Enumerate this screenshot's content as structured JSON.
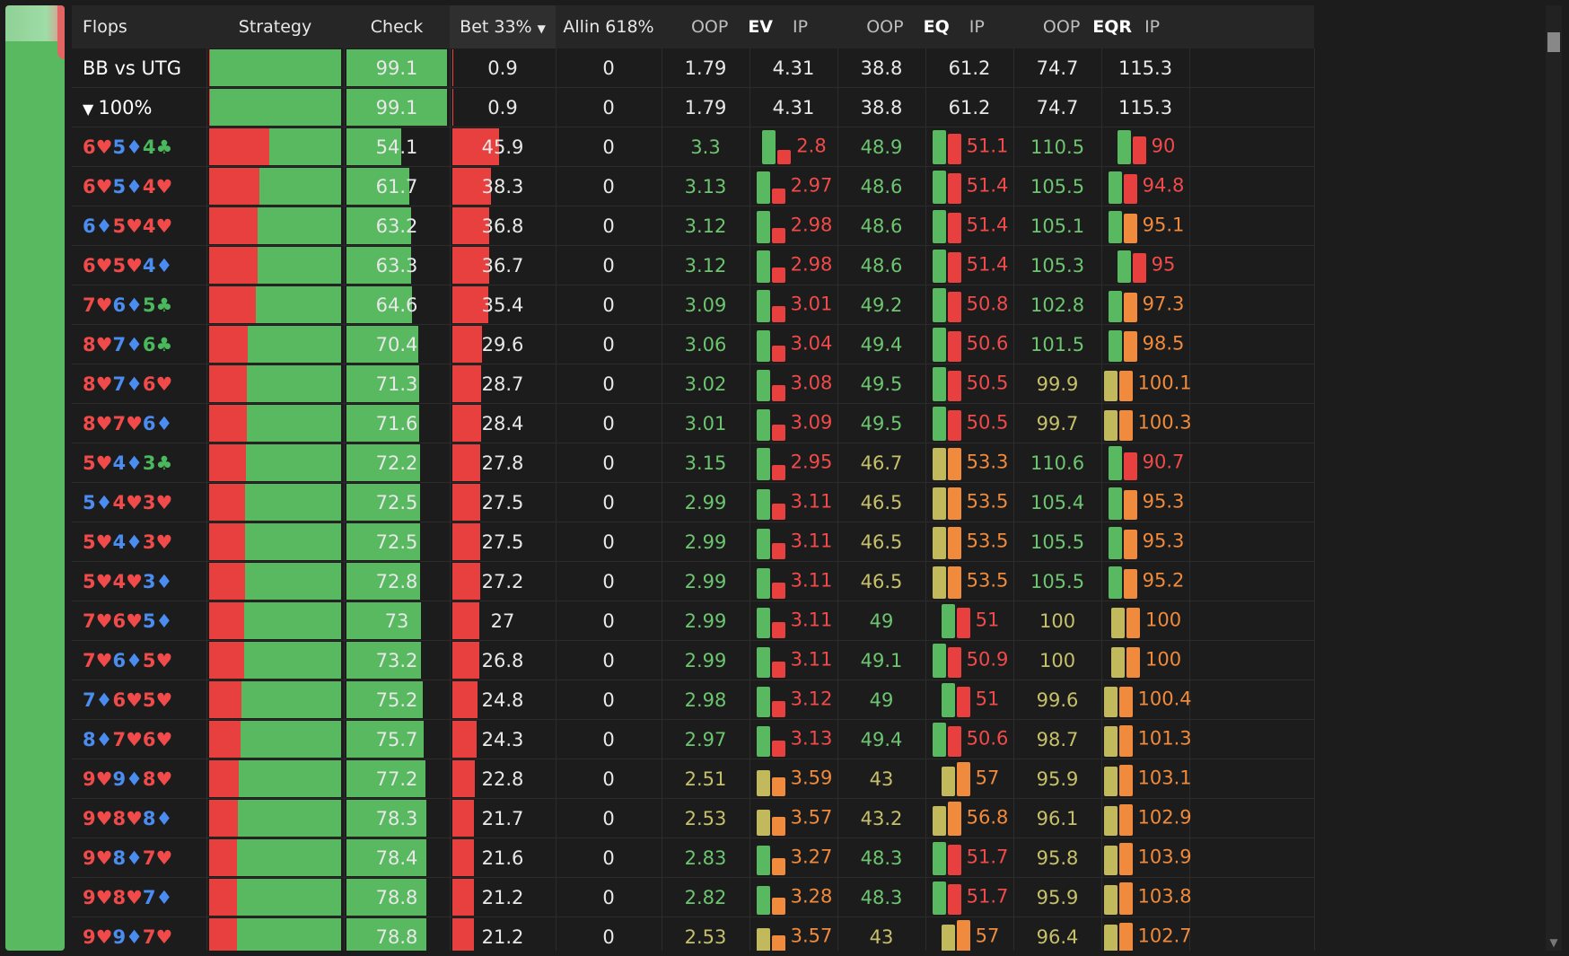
{
  "header": {
    "flops": "Flops",
    "strategy": "Strategy",
    "check": "Check",
    "bet": "Bet 33%",
    "allin": "Allin 618%",
    "ev_oop": "OOP",
    "ev": "EV",
    "ev_ip": "IP",
    "eq_oop": "OOP",
    "eq": "EQ",
    "eq_ip": "IP",
    "eqr_oop": "OOP",
    "eqr": "EQR",
    "eqr_ip": "IP"
  },
  "summary": [
    {
      "label": "BB vs UTG",
      "check": "99.1",
      "bet": "0.9",
      "allin": "0",
      "ev_oop": "1.79",
      "ev_ip": "4.31",
      "eq_oop": "38.8",
      "eq_ip": "61.2",
      "eqr_oop": "74.7",
      "eqr_ip": "115.3"
    },
    {
      "label": "100%",
      "filter_icon": "filter-icon",
      "check": "99.1",
      "bet": "0.9",
      "allin": "0",
      "ev_oop": "1.79",
      "ev_ip": "4.31",
      "eq_oop": "38.8",
      "eq_ip": "61.2",
      "eqr_oop": "74.7",
      "eqr_ip": "115.3"
    }
  ],
  "rows": [
    {
      "cards": [
        [
          "6",
          "h"
        ],
        [
          "5",
          "d"
        ],
        [
          "4",
          "c"
        ]
      ],
      "check": "54.1",
      "bet": "45.9",
      "allin": "0",
      "ev_oop": "3.3",
      "ev_ip": "2.8",
      "eq_oop": "48.9",
      "eq_ip": "51.1",
      "eqr_oop": "110.5",
      "eqr_ip": "90"
    },
    {
      "cards": [
        [
          "6",
          "h"
        ],
        [
          "5",
          "d"
        ],
        [
          "4",
          "h"
        ]
      ],
      "check": "61.7",
      "bet": "38.3",
      "allin": "0",
      "ev_oop": "3.13",
      "ev_ip": "2.97",
      "eq_oop": "48.6",
      "eq_ip": "51.4",
      "eqr_oop": "105.5",
      "eqr_ip": "94.8"
    },
    {
      "cards": [
        [
          "6",
          "d"
        ],
        [
          "5",
          "h"
        ],
        [
          "4",
          "h"
        ]
      ],
      "check": "63.2",
      "bet": "36.8",
      "allin": "0",
      "ev_oop": "3.12",
      "ev_ip": "2.98",
      "eq_oop": "48.6",
      "eq_ip": "51.4",
      "eqr_oop": "105.1",
      "eqr_ip": "95.1"
    },
    {
      "cards": [
        [
          "6",
          "h"
        ],
        [
          "5",
          "h"
        ],
        [
          "4",
          "d"
        ]
      ],
      "check": "63.3",
      "bet": "36.7",
      "allin": "0",
      "ev_oop": "3.12",
      "ev_ip": "2.98",
      "eq_oop": "48.6",
      "eq_ip": "51.4",
      "eqr_oop": "105.3",
      "eqr_ip": "95"
    },
    {
      "cards": [
        [
          "7",
          "h"
        ],
        [
          "6",
          "d"
        ],
        [
          "5",
          "c"
        ]
      ],
      "check": "64.6",
      "bet": "35.4",
      "allin": "0",
      "ev_oop": "3.09",
      "ev_ip": "3.01",
      "eq_oop": "49.2",
      "eq_ip": "50.8",
      "eqr_oop": "102.8",
      "eqr_ip": "97.3"
    },
    {
      "cards": [
        [
          "8",
          "h"
        ],
        [
          "7",
          "d"
        ],
        [
          "6",
          "c"
        ]
      ],
      "check": "70.4",
      "bet": "29.6",
      "allin": "0",
      "ev_oop": "3.06",
      "ev_ip": "3.04",
      "eq_oop": "49.4",
      "eq_ip": "50.6",
      "eqr_oop": "101.5",
      "eqr_ip": "98.5"
    },
    {
      "cards": [
        [
          "8",
          "h"
        ],
        [
          "7",
          "d"
        ],
        [
          "6",
          "h"
        ]
      ],
      "check": "71.3",
      "bet": "28.7",
      "allin": "0",
      "ev_oop": "3.02",
      "ev_ip": "3.08",
      "eq_oop": "49.5",
      "eq_ip": "50.5",
      "eqr_oop": "99.9",
      "eqr_ip": "100.1"
    },
    {
      "cards": [
        [
          "8",
          "h"
        ],
        [
          "7",
          "h"
        ],
        [
          "6",
          "d"
        ]
      ],
      "check": "71.6",
      "bet": "28.4",
      "allin": "0",
      "ev_oop": "3.01",
      "ev_ip": "3.09",
      "eq_oop": "49.5",
      "eq_ip": "50.5",
      "eqr_oop": "99.7",
      "eqr_ip": "100.3"
    },
    {
      "cards": [
        [
          "5",
          "h"
        ],
        [
          "4",
          "d"
        ],
        [
          "3",
          "c"
        ]
      ],
      "check": "72.2",
      "bet": "27.8",
      "allin": "0",
      "ev_oop": "3.15",
      "ev_ip": "2.95",
      "eq_oop": "46.7",
      "eq_ip": "53.3",
      "eqr_oop": "110.6",
      "eqr_ip": "90.7"
    },
    {
      "cards": [
        [
          "5",
          "d"
        ],
        [
          "4",
          "h"
        ],
        [
          "3",
          "h"
        ]
      ],
      "check": "72.5",
      "bet": "27.5",
      "allin": "0",
      "ev_oop": "2.99",
      "ev_ip": "3.11",
      "eq_oop": "46.5",
      "eq_ip": "53.5",
      "eqr_oop": "105.4",
      "eqr_ip": "95.3"
    },
    {
      "cards": [
        [
          "5",
          "h"
        ],
        [
          "4",
          "d"
        ],
        [
          "3",
          "h"
        ]
      ],
      "check": "72.5",
      "bet": "27.5",
      "allin": "0",
      "ev_oop": "2.99",
      "ev_ip": "3.11",
      "eq_oop": "46.5",
      "eq_ip": "53.5",
      "eqr_oop": "105.5",
      "eqr_ip": "95.3"
    },
    {
      "cards": [
        [
          "5",
          "h"
        ],
        [
          "4",
          "h"
        ],
        [
          "3",
          "d"
        ]
      ],
      "check": "72.8",
      "bet": "27.2",
      "allin": "0",
      "ev_oop": "2.99",
      "ev_ip": "3.11",
      "eq_oop": "46.5",
      "eq_ip": "53.5",
      "eqr_oop": "105.5",
      "eqr_ip": "95.2"
    },
    {
      "cards": [
        [
          "7",
          "h"
        ],
        [
          "6",
          "h"
        ],
        [
          "5",
          "d"
        ]
      ],
      "check": "73",
      "bet": "27",
      "allin": "0",
      "ev_oop": "2.99",
      "ev_ip": "3.11",
      "eq_oop": "49",
      "eq_ip": "51",
      "eqr_oop": "100",
      "eqr_ip": "100"
    },
    {
      "cards": [
        [
          "7",
          "h"
        ],
        [
          "6",
          "d"
        ],
        [
          "5",
          "h"
        ]
      ],
      "check": "73.2",
      "bet": "26.8",
      "allin": "0",
      "ev_oop": "2.99",
      "ev_ip": "3.11",
      "eq_oop": "49.1",
      "eq_ip": "50.9",
      "eqr_oop": "100",
      "eqr_ip": "100"
    },
    {
      "cards": [
        [
          "7",
          "d"
        ],
        [
          "6",
          "h"
        ],
        [
          "5",
          "h"
        ]
      ],
      "check": "75.2",
      "bet": "24.8",
      "allin": "0",
      "ev_oop": "2.98",
      "ev_ip": "3.12",
      "eq_oop": "49",
      "eq_ip": "51",
      "eqr_oop": "99.6",
      "eqr_ip": "100.4"
    },
    {
      "cards": [
        [
          "8",
          "d"
        ],
        [
          "7",
          "h"
        ],
        [
          "6",
          "h"
        ]
      ],
      "check": "75.7",
      "bet": "24.3",
      "allin": "0",
      "ev_oop": "2.97",
      "ev_ip": "3.13",
      "eq_oop": "49.4",
      "eq_ip": "50.6",
      "eqr_oop": "98.7",
      "eqr_ip": "101.3"
    },
    {
      "cards": [
        [
          "9",
          "h"
        ],
        [
          "9",
          "d"
        ],
        [
          "8",
          "h"
        ]
      ],
      "check": "77.2",
      "bet": "22.8",
      "allin": "0",
      "ev_oop": "2.51",
      "ev_ip": "3.59",
      "eq_oop": "43",
      "eq_ip": "57",
      "eqr_oop": "95.9",
      "eqr_ip": "103.1"
    },
    {
      "cards": [
        [
          "9",
          "h"
        ],
        [
          "8",
          "h"
        ],
        [
          "8",
          "d"
        ]
      ],
      "check": "78.3",
      "bet": "21.7",
      "allin": "0",
      "ev_oop": "2.53",
      "ev_ip": "3.57",
      "eq_oop": "43.2",
      "eq_ip": "56.8",
      "eqr_oop": "96.1",
      "eqr_ip": "102.9"
    },
    {
      "cards": [
        [
          "9",
          "h"
        ],
        [
          "8",
          "d"
        ],
        [
          "7",
          "h"
        ]
      ],
      "check": "78.4",
      "bet": "21.6",
      "allin": "0",
      "ev_oop": "2.83",
      "ev_ip": "3.27",
      "eq_oop": "48.3",
      "eq_ip": "51.7",
      "eqr_oop": "95.8",
      "eqr_ip": "103.9"
    },
    {
      "cards": [
        [
          "9",
          "h"
        ],
        [
          "8",
          "h"
        ],
        [
          "7",
          "d"
        ]
      ],
      "check": "78.8",
      "bet": "21.2",
      "allin": "0",
      "ev_oop": "2.82",
      "ev_ip": "3.28",
      "eq_oop": "48.3",
      "eq_ip": "51.7",
      "eqr_oop": "95.9",
      "eqr_ip": "103.8"
    },
    {
      "cards": [
        [
          "9",
          "h"
        ],
        [
          "9",
          "d"
        ],
        [
          "7",
          "h"
        ]
      ],
      "check": "78.8",
      "bet": "21.2",
      "allin": "0",
      "ev_oop": "2.53",
      "ev_ip": "3.57",
      "eq_oop": "43",
      "eq_ip": "57",
      "eqr_oop": "96.4",
      "eqr_ip": "102.7"
    }
  ],
  "colors": {
    "green": "#58b961",
    "red": "#e8403f",
    "orange": "#f08a3c",
    "olive": "#c2b85c",
    "heart": "#f04a4a",
    "diamond": "#4a8cf0",
    "club": "#4ab85c",
    "val_green": "#6cc56f",
    "val_red": "#f04a4a",
    "val_orange": "#f08a3c",
    "val_olive": "#c6c06a"
  }
}
